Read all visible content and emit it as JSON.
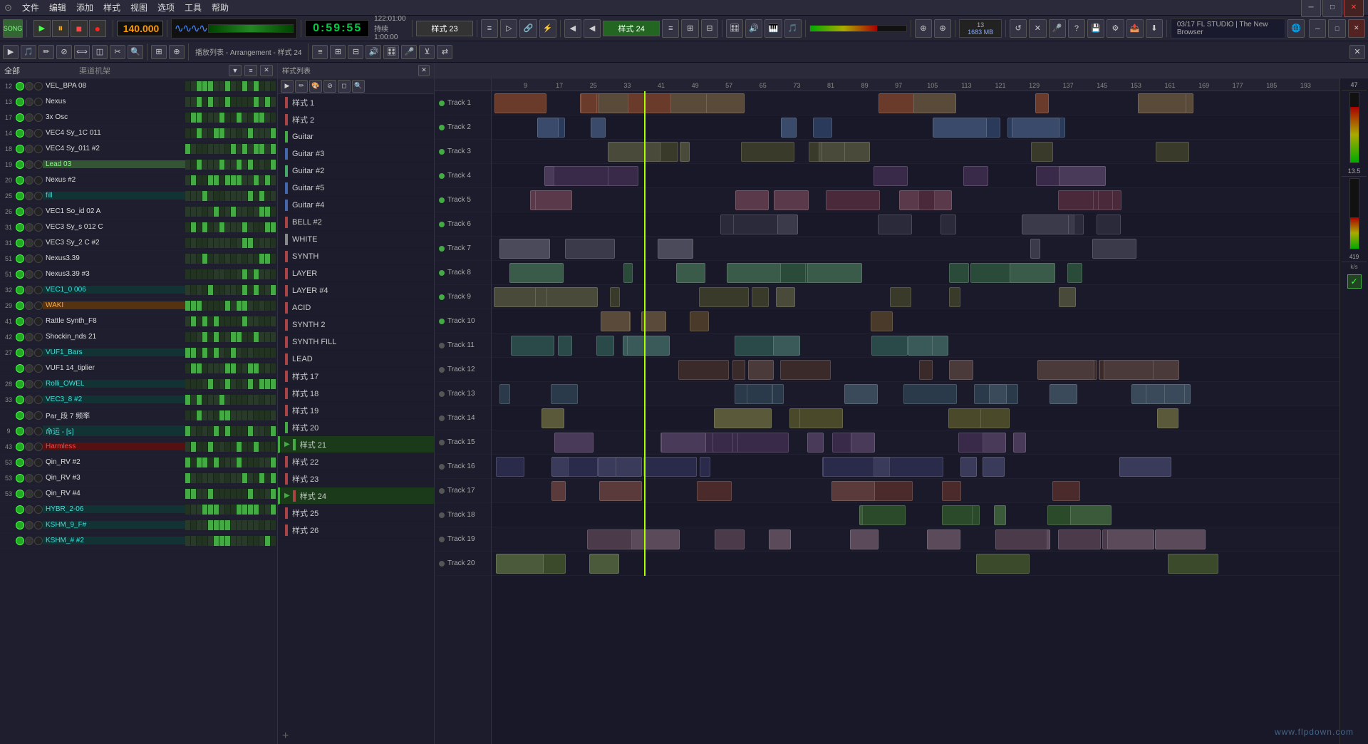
{
  "menu": {
    "items": [
      "文件",
      "编辑",
      "添加",
      "样式",
      "视图",
      "选项",
      "工具",
      "帮助"
    ]
  },
  "toolbar": {
    "bpm": "140.000",
    "time": "0:59:55",
    "song_pos": "122:01:00",
    "song_dur": "持续 1:00:00",
    "pattern_left": "样式 23",
    "pattern_right": "样式 24",
    "cpu": "13",
    "ram": "1683 MB",
    "fl_info": "03/17  FL STUDIO | The New Browser"
  },
  "channel_rack": {
    "title": "全部",
    "subtitle": "渠道机架",
    "channels": [
      {
        "num": "12",
        "name": "VEL_BPA 08",
        "type": "default"
      },
      {
        "num": "13",
        "name": "Nexus",
        "type": "default"
      },
      {
        "num": "17",
        "name": "3x Osc",
        "type": "default"
      },
      {
        "num": "14",
        "name": "VEC4 Sy_1C 011",
        "type": "default"
      },
      {
        "num": "18",
        "name": "VEC4 Sy_011 #2",
        "type": "default"
      },
      {
        "num": "19",
        "name": "Lead 03",
        "type": "highlight"
      },
      {
        "num": "20",
        "name": "Nexus #2",
        "type": "default"
      },
      {
        "num": "25",
        "name": "fill",
        "type": "teal"
      },
      {
        "num": "26",
        "name": "VEC1 So_id 02 A",
        "type": "default"
      },
      {
        "num": "31",
        "name": "VEC3 Sy_s 012 C",
        "type": "default"
      },
      {
        "num": "31",
        "name": "VEC3 Sy_2 C #2",
        "type": "default"
      },
      {
        "num": "51",
        "name": "Nexus3.39",
        "type": "default"
      },
      {
        "num": "51",
        "name": "Nexus3.39 #3",
        "type": "default"
      },
      {
        "num": "32",
        "name": "VEC1_0 006",
        "type": "teal"
      },
      {
        "num": "29",
        "name": "WAKI",
        "type": "orange"
      },
      {
        "num": "41",
        "name": "Rattle Synth_F8",
        "type": "default"
      },
      {
        "num": "42",
        "name": "Shockin_nds 21",
        "type": "default"
      },
      {
        "num": "27",
        "name": "VUF1_Bars",
        "type": "teal"
      },
      {
        "num": "",
        "name": "VUF1 14_tiplier",
        "type": "default"
      },
      {
        "num": "28",
        "name": "Rolli_OWEL",
        "type": "teal"
      },
      {
        "num": "33",
        "name": "VEC3_8 #2",
        "type": "teal"
      },
      {
        "num": "",
        "name": "Par_段 7 频率",
        "type": "default"
      },
      {
        "num": "9",
        "name": "命运 - [s]",
        "type": "teal"
      },
      {
        "num": "43",
        "name": "Harmless",
        "type": "red"
      },
      {
        "num": "53",
        "name": "Qin_RV #2",
        "type": "default"
      },
      {
        "num": "53",
        "name": "Qin_RV #3",
        "type": "default"
      },
      {
        "num": "53",
        "name": "Qin_RV #4",
        "type": "default"
      },
      {
        "num": "",
        "name": "HYBR_2-06",
        "type": "teal"
      },
      {
        "num": "",
        "name": "KSHM_9_F#",
        "type": "teal"
      },
      {
        "num": "",
        "name": "KSHM_# #2",
        "type": "teal"
      }
    ]
  },
  "pattern_list": {
    "title": "播放列表 - Arrangement - 样式 24",
    "patterns": [
      {
        "label": "样式 1",
        "color": "#aa4444",
        "active": false
      },
      {
        "label": "样式 2",
        "color": "#aa4444",
        "active": false
      },
      {
        "label": "Guitar",
        "color": "#44aa44",
        "active": false
      },
      {
        "label": "Guitar #3",
        "color": "#4466aa",
        "active": false
      },
      {
        "label": "Guitar #2",
        "color": "#44aa66",
        "active": false
      },
      {
        "label": "Guitar #5",
        "color": "#4466aa",
        "active": false
      },
      {
        "label": "Guitar #4",
        "color": "#4466aa",
        "active": false
      },
      {
        "label": "BELL #2",
        "color": "#aa4444",
        "active": false
      },
      {
        "label": "WHITE",
        "color": "#888888",
        "active": false
      },
      {
        "label": "SYNTH",
        "color": "#aa4444",
        "active": false
      },
      {
        "label": "LAYER",
        "color": "#aa4444",
        "active": false
      },
      {
        "label": "LAYER #4",
        "color": "#aa4444",
        "active": false
      },
      {
        "label": "ACID",
        "color": "#aa4444",
        "active": false
      },
      {
        "label": "SYNTH 2",
        "color": "#aa4444",
        "active": false
      },
      {
        "label": "SYNTH FILL",
        "color": "#aa4444",
        "active": false
      },
      {
        "label": "LEAD",
        "color": "#aa4444",
        "active": false
      },
      {
        "label": "样式 17",
        "color": "#aa4444",
        "active": false
      },
      {
        "label": "样式 18",
        "color": "#aa4444",
        "active": false
      },
      {
        "label": "样式 19",
        "color": "#aa4444",
        "active": false
      },
      {
        "label": "样式 20",
        "color": "#44aa44",
        "active": false
      },
      {
        "label": "样式 21",
        "color": "#44aa44",
        "active": true
      },
      {
        "label": "样式 22",
        "color": "#aa4444",
        "active": false
      },
      {
        "label": "样式 23",
        "color": "#aa4444",
        "active": false
      },
      {
        "label": "样式 24",
        "color": "#aa4444",
        "active": true
      },
      {
        "label": "样式 25",
        "color": "#aa4444",
        "active": false
      },
      {
        "label": "样式 26",
        "color": "#aa4444",
        "active": false
      }
    ]
  },
  "arrangement": {
    "tracks": [
      {
        "label": "Track 1"
      },
      {
        "label": "Track 2"
      },
      {
        "label": "Track 3"
      },
      {
        "label": "Track 4"
      },
      {
        "label": "Track 5"
      },
      {
        "label": "Track 6"
      },
      {
        "label": "Track 7"
      },
      {
        "label": "Track 8"
      },
      {
        "label": "Track 9"
      },
      {
        "label": "Track 10"
      },
      {
        "label": "Track 11"
      },
      {
        "label": "Track 12"
      },
      {
        "label": "Track 13"
      },
      {
        "label": "Track 14"
      },
      {
        "label": "Track 15"
      },
      {
        "label": "Track 16"
      },
      {
        "label": "Track 17"
      },
      {
        "label": "Track 18"
      },
      {
        "label": "Track 19"
      },
      {
        "label": "Track 20"
      }
    ],
    "ruler_marks": [
      9,
      17,
      25,
      33,
      41,
      49,
      57,
      65,
      73,
      81,
      89,
      97,
      105,
      113,
      121,
      129,
      137,
      145,
      153,
      161,
      169,
      177,
      185,
      193
    ],
    "levels": {
      "db": "47",
      "mid": "13.5",
      "low": "419"
    }
  },
  "watermark": "www.flpdown.com"
}
